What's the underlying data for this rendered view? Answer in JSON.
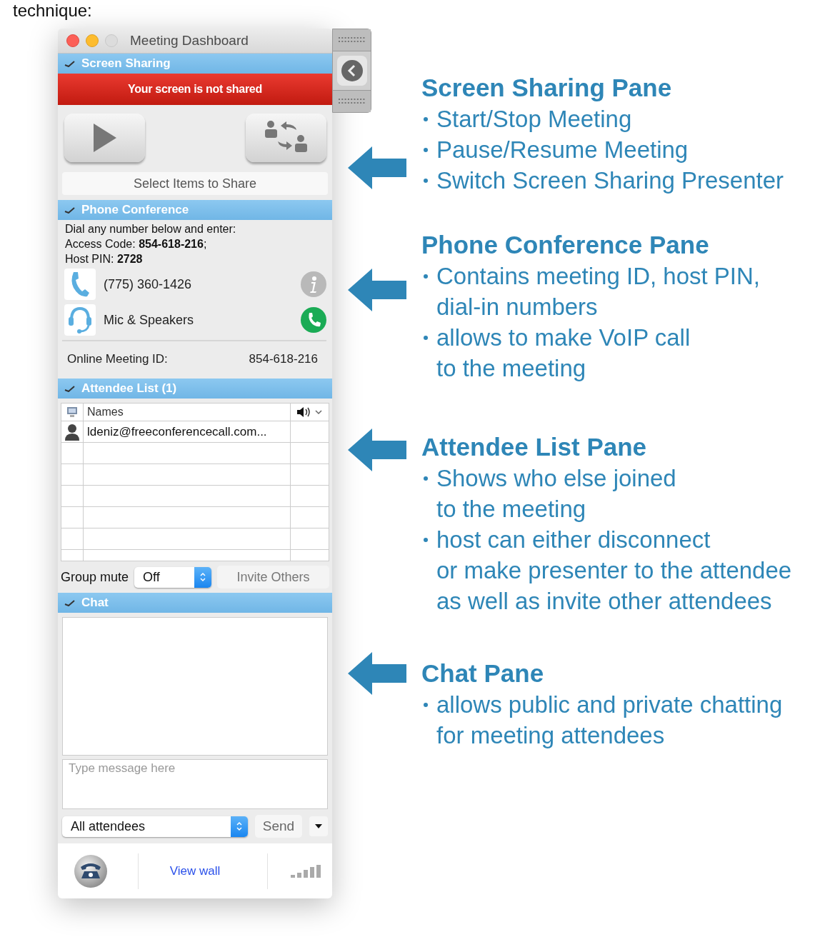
{
  "caption": "technique:",
  "window": {
    "title": "Meeting Dashboard",
    "screen_sharing": {
      "header": "Screen Sharing",
      "banner": "Your screen is not shared",
      "select_items": "Select Items to Share"
    },
    "phone_conference": {
      "header": "Phone Conference",
      "instructions": "Dial any number below and enter:",
      "access_code": "Access Code: **854-618-216**;",
      "host_pin": "Host PIN: **2728**",
      "lines": [
        {
          "kind": "phone",
          "label": "(775) 360-1426"
        },
        {
          "kind": "voip",
          "label": "Mic & Speakers"
        }
      ],
      "meeting_id_label": "Online Meeting ID:",
      "meeting_id": "854-618-216"
    },
    "attendee_list": {
      "header": "Attendee List (1)",
      "columns": [
        "Names"
      ],
      "rows": [
        {
          "name": "ldeniz@freeconferencecall.com..."
        }
      ],
      "group_mute_label": "Group mute",
      "group_mute": "Off",
      "invite_button": "Invite Others"
    },
    "chat": {
      "header": "Chat",
      "placeholder": "Type message here",
      "recipient": "All attendees",
      "send_button": "Send"
    },
    "footer": {
      "link": "View wall"
    }
  },
  "annotations": [
    {
      "title": "Screen Sharing Pane",
      "bullets": [
        {
          "lines": [
            "Start/Stop Meeting"
          ]
        },
        {
          "lines": [
            "Pause/Resume Meeting"
          ]
        },
        {
          "lines": [
            "Switch Screen Sharing Presenter"
          ]
        }
      ]
    },
    {
      "title": "Phone Conference Pane",
      "bullets": [
        {
          "lines": [
            "Contains meeting ID, host PIN,",
            "dial-in numbers"
          ]
        },
        {
          "lines": [
            "allows to make VoIP call",
            "to the meeting"
          ]
        }
      ]
    },
    {
      "title": "Attendee List Pane",
      "bullets": [
        {
          "lines": [
            "Shows who else joined",
            "to the meeting"
          ]
        },
        {
          "lines": [
            "host can either disconnect",
            "or make presenter to the attendee",
            "as well as invite other attendees"
          ]
        }
      ]
    },
    {
      "title": "Chat Pane",
      "bullets": [
        {
          "lines": [
            "allows public and private chatting",
            "for meeting attendees"
          ]
        }
      ]
    }
  ]
}
